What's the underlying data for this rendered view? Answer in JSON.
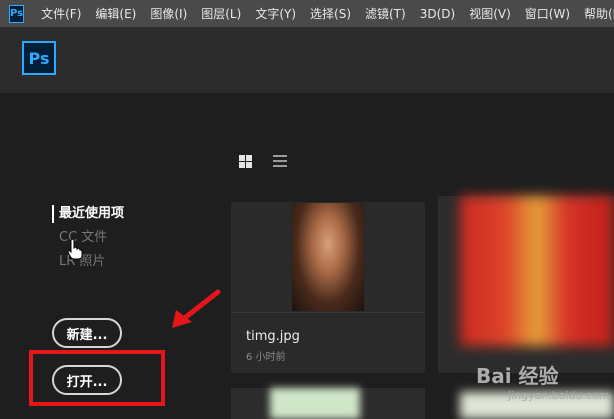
{
  "menubar": {
    "logo_text": "Ps",
    "items": [
      "文件(F)",
      "编辑(E)",
      "图像(I)",
      "图层(L)",
      "文字(Y)",
      "选择(S)",
      "滤镜(T)",
      "3D(D)",
      "视图(V)",
      "窗口(W)",
      "帮助(H)"
    ]
  },
  "app": {
    "logo_text": "Ps"
  },
  "sidebar": {
    "items": [
      {
        "label": "最近使用项",
        "active": true
      },
      {
        "label": "CC 文件",
        "active": false
      },
      {
        "label": "LR 照片",
        "active": false
      }
    ]
  },
  "buttons": {
    "new_label": "新建...",
    "open_label": "打开..."
  },
  "recent": {
    "file_name": "timg.jpg",
    "file_time": "6 小时前"
  },
  "watermark": {
    "brand": "Bai 经验",
    "url": "jingyan.baidu.com"
  },
  "colors": {
    "accent": "#31a8ff",
    "highlight": "#e3161a"
  }
}
